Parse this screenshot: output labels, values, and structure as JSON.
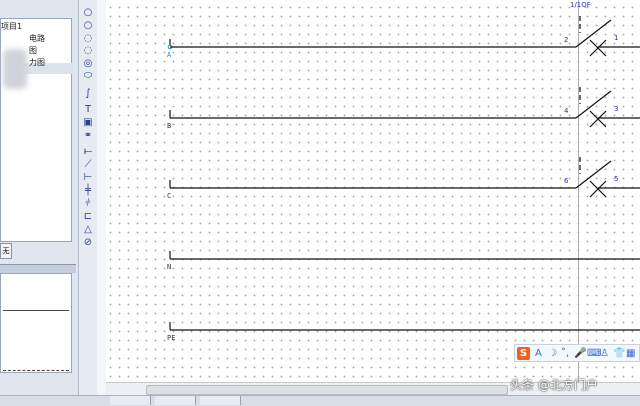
{
  "project_tree": {
    "items": [
      "项目1",
      "电路",
      "图",
      "力图"
    ]
  },
  "left_tab": "无",
  "tool_icons": [
    "circle-icon",
    "circle-icon",
    "arc-icon",
    "arc-icon",
    "spiral-icon",
    "ellipse-icon",
    "curve-icon",
    "text-icon",
    "image-icon",
    "link-icon",
    "wire-icon",
    "diagonal-wire-icon",
    "terminal-icon",
    "bus-icon",
    "multi-wire-icon",
    "bracket-icon",
    "triangle-icon",
    "probe-icon"
  ],
  "schematic": {
    "device_label": "1/1QF",
    "rows": [
      {
        "terminal": "A",
        "contact_left": "2",
        "contact_right": "1",
        "has_breaker": true
      },
      {
        "terminal": "B",
        "contact_left": "4",
        "contact_right": "3",
        "has_breaker": true
      },
      {
        "terminal": "C",
        "contact_left": "6",
        "contact_right": "5",
        "has_breaker": true
      },
      {
        "terminal": "N",
        "has_breaker": false
      },
      {
        "terminal": "PE",
        "has_breaker": false
      }
    ]
  },
  "ime_toolbar": {
    "logo": "S",
    "items": [
      "A",
      "☽",
      "˚,",
      "mic-icon",
      "keyboard-icon",
      "person-icon",
      "shirt-icon",
      "grid-icon"
    ],
    "accent": "#f0601f"
  },
  "watermark": "头条 @北方门户"
}
